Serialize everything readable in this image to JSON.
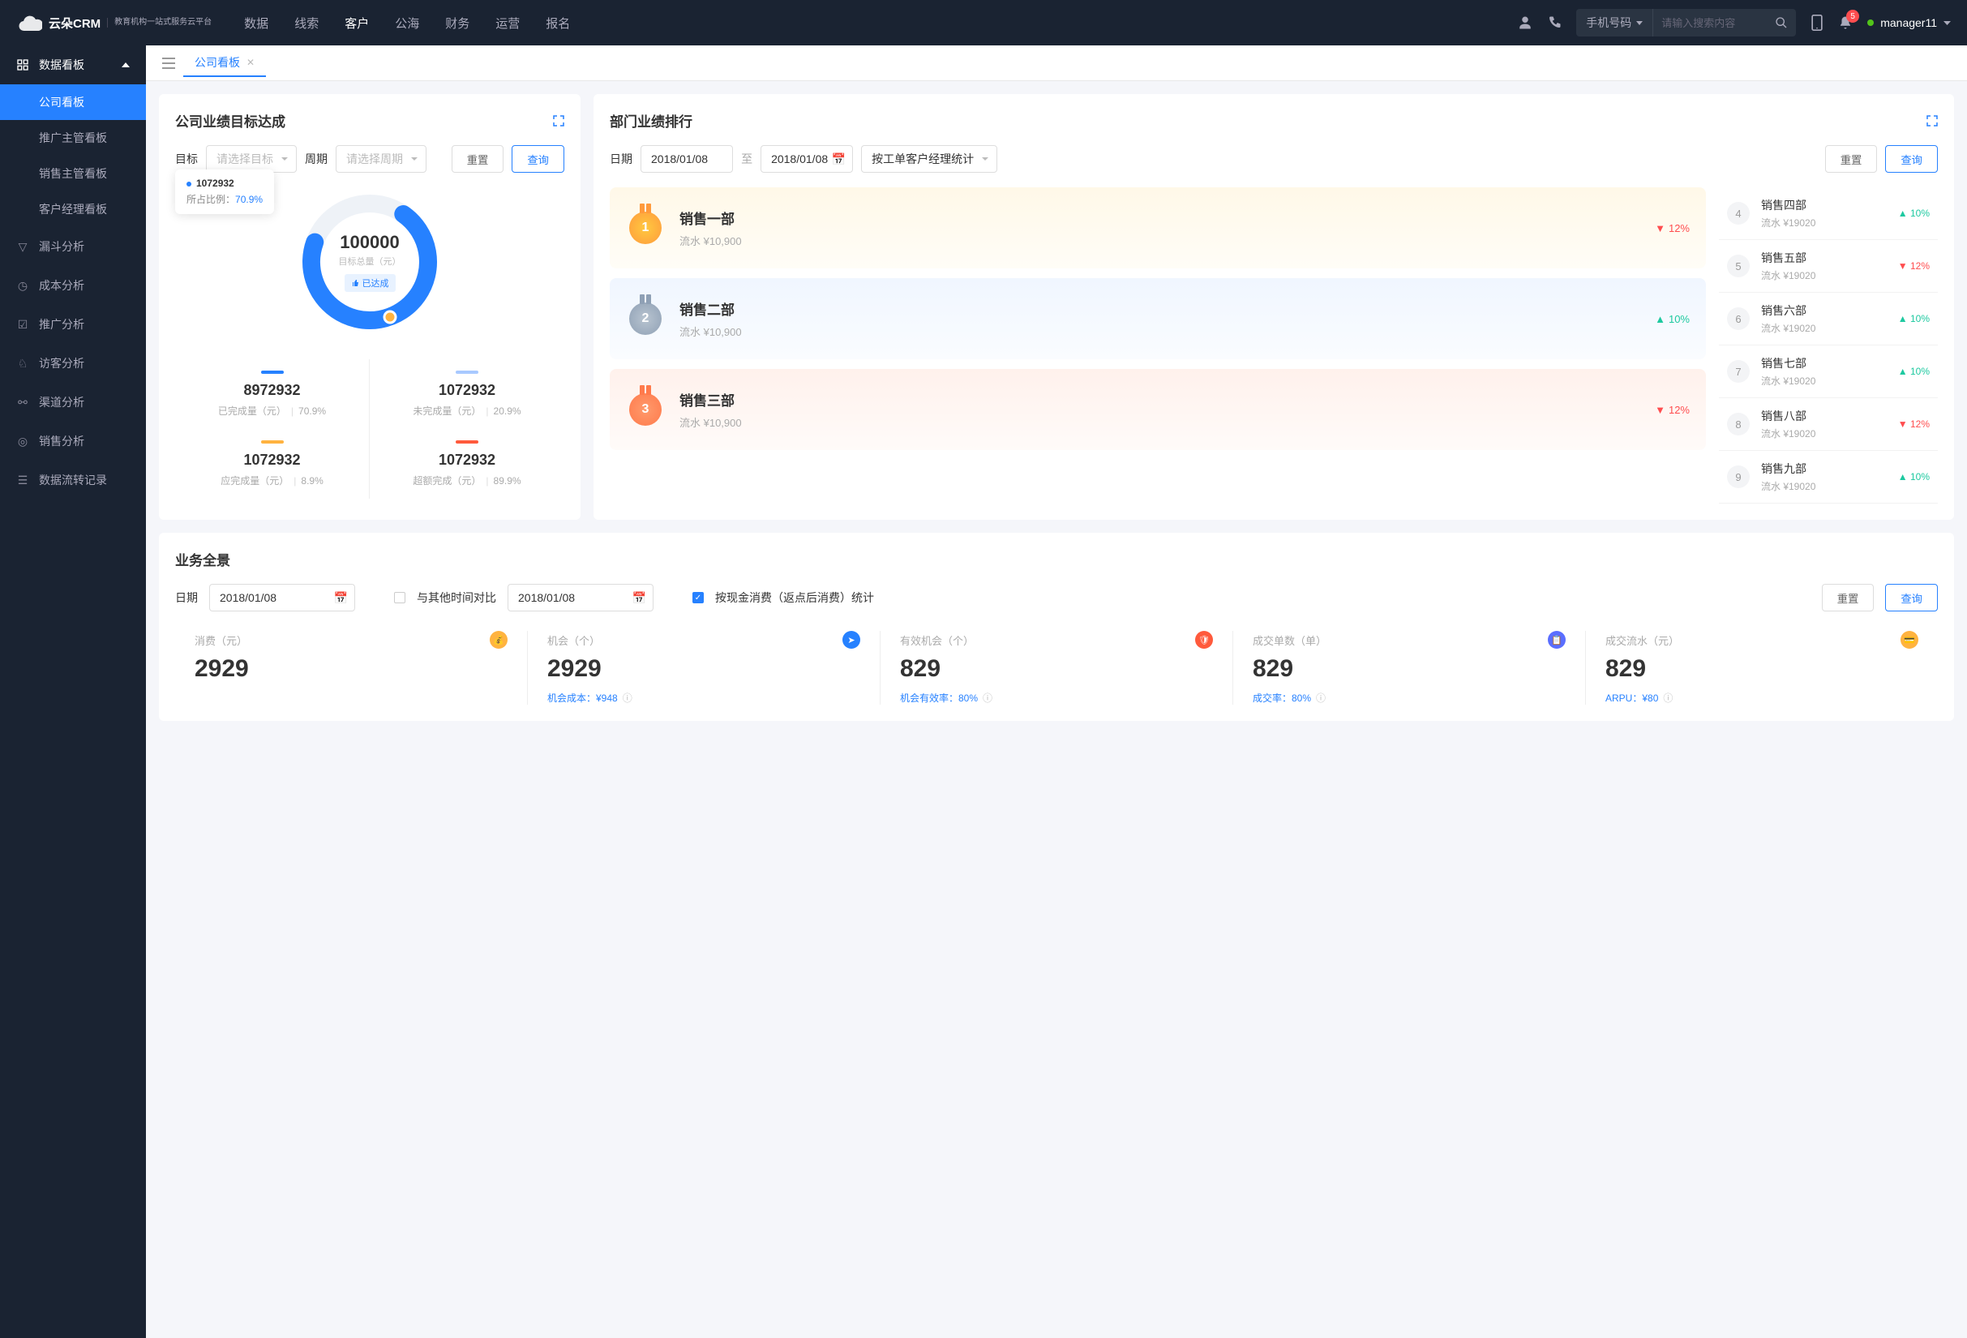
{
  "header": {
    "brand": "云朵CRM",
    "brand_sub": "教育机构一站式服务云平台",
    "nav": [
      "数据",
      "线索",
      "客户",
      "公海",
      "财务",
      "运营",
      "报名"
    ],
    "nav_active": 2,
    "search_type": "手机号码",
    "search_placeholder": "请输入搜索内容",
    "notif_count": "5",
    "user": "manager11"
  },
  "sidebar": {
    "parent": "数据看板",
    "subs": [
      "公司看板",
      "推广主管看板",
      "销售主管看板",
      "客户经理看板"
    ],
    "active_sub": 0,
    "items": [
      "漏斗分析",
      "成本分析",
      "推广分析",
      "访客分析",
      "渠道分析",
      "销售分析",
      "数据流转记录"
    ]
  },
  "tabbar": {
    "tab": "公司看板"
  },
  "goal": {
    "title": "公司业绩目标达成",
    "target_label": "目标",
    "target_ph": "请选择目标",
    "period_label": "周期",
    "period_ph": "请选择周期",
    "reset": "重置",
    "query": "查询",
    "tooltip_val": "1072932",
    "tooltip_lbl": "所占比例：",
    "tooltip_pct": "70.9%",
    "center_val": "100000",
    "center_lbl": "目标总量（元）",
    "center_badge": "已达成",
    "stats": [
      {
        "color": "#2681ff",
        "num": "8972932",
        "label": "已完成量（元）",
        "pct": "70.9%"
      },
      {
        "color": "#a8c9ff",
        "num": "1072932",
        "label": "未完成量（元）",
        "pct": "20.9%"
      },
      {
        "color": "#ffb340",
        "num": "1072932",
        "label": "应完成量（元）",
        "pct": "8.9%"
      },
      {
        "color": "#ff5a3c",
        "num": "1072932",
        "label": "超额完成（元）",
        "pct": "89.9%"
      }
    ]
  },
  "rank": {
    "title": "部门业绩排行",
    "date_label": "日期",
    "date1": "2018/01/08",
    "date_to": "至",
    "date2": "2018/01/08",
    "mode": "按工单客户经理统计",
    "reset": "重置",
    "query": "查询",
    "top3": [
      {
        "name": "销售一部",
        "rev": "流水 ¥10,900",
        "pct": "12%",
        "dir": "down",
        "medal": "1"
      },
      {
        "name": "销售二部",
        "rev": "流水 ¥10,900",
        "pct": "10%",
        "dir": "up",
        "medal": "2"
      },
      {
        "name": "销售三部",
        "rev": "流水 ¥10,900",
        "pct": "12%",
        "dir": "down",
        "medal": "3"
      }
    ],
    "rest": [
      {
        "n": "4",
        "name": "销售四部",
        "rev": "流水 ¥19020",
        "pct": "10%",
        "dir": "up"
      },
      {
        "n": "5",
        "name": "销售五部",
        "rev": "流水 ¥19020",
        "pct": "12%",
        "dir": "down"
      },
      {
        "n": "6",
        "name": "销售六部",
        "rev": "流水 ¥19020",
        "pct": "10%",
        "dir": "up"
      },
      {
        "n": "7",
        "name": "销售七部",
        "rev": "流水 ¥19020",
        "pct": "10%",
        "dir": "up"
      },
      {
        "n": "8",
        "name": "销售八部",
        "rev": "流水 ¥19020",
        "pct": "12%",
        "dir": "down"
      },
      {
        "n": "9",
        "name": "销售九部",
        "rev": "流水 ¥19020",
        "pct": "10%",
        "dir": "up"
      }
    ]
  },
  "overview": {
    "title": "业务全景",
    "date_label": "日期",
    "date1": "2018/01/08",
    "compare": "与其他时间对比",
    "date2": "2018/01/08",
    "chkbox_lbl": "按现金消费（返点后消费）统计",
    "reset": "重置",
    "query": "查询",
    "cells": [
      {
        "label": "消费（元）",
        "val": "2929",
        "sub": "",
        "ico": "#ffb340"
      },
      {
        "label": "机会（个）",
        "val": "2929",
        "sub": "机会成本：¥948",
        "ico": "#2681ff"
      },
      {
        "label": "有效机会（个）",
        "val": "829",
        "sub": "机会有效率：80%",
        "ico": "#ff5a3c"
      },
      {
        "label": "成交单数（单）",
        "val": "829",
        "sub": "成交率：80%",
        "ico": "#5a6eff"
      },
      {
        "label": "成交流水（元）",
        "val": "829",
        "sub": "ARPU：¥80",
        "ico": "#ffb340"
      }
    ]
  },
  "chart_data": {
    "type": "pie",
    "title": "公司业绩目标达成",
    "total_label": "目标总量（元）",
    "total": 100000,
    "series": [
      {
        "name": "已完成量",
        "value": 8972932,
        "pct": 70.9,
        "color": "#2681ff"
      },
      {
        "name": "未完成量",
        "value": 1072932,
        "pct": 20.9,
        "color": "#a8c9ff"
      },
      {
        "name": "应完成量",
        "value": 1072932,
        "pct": 8.9,
        "color": "#ffb340"
      },
      {
        "name": "超额完成",
        "value": 1072932,
        "pct": 89.9,
        "color": "#ff5a3c"
      }
    ]
  }
}
